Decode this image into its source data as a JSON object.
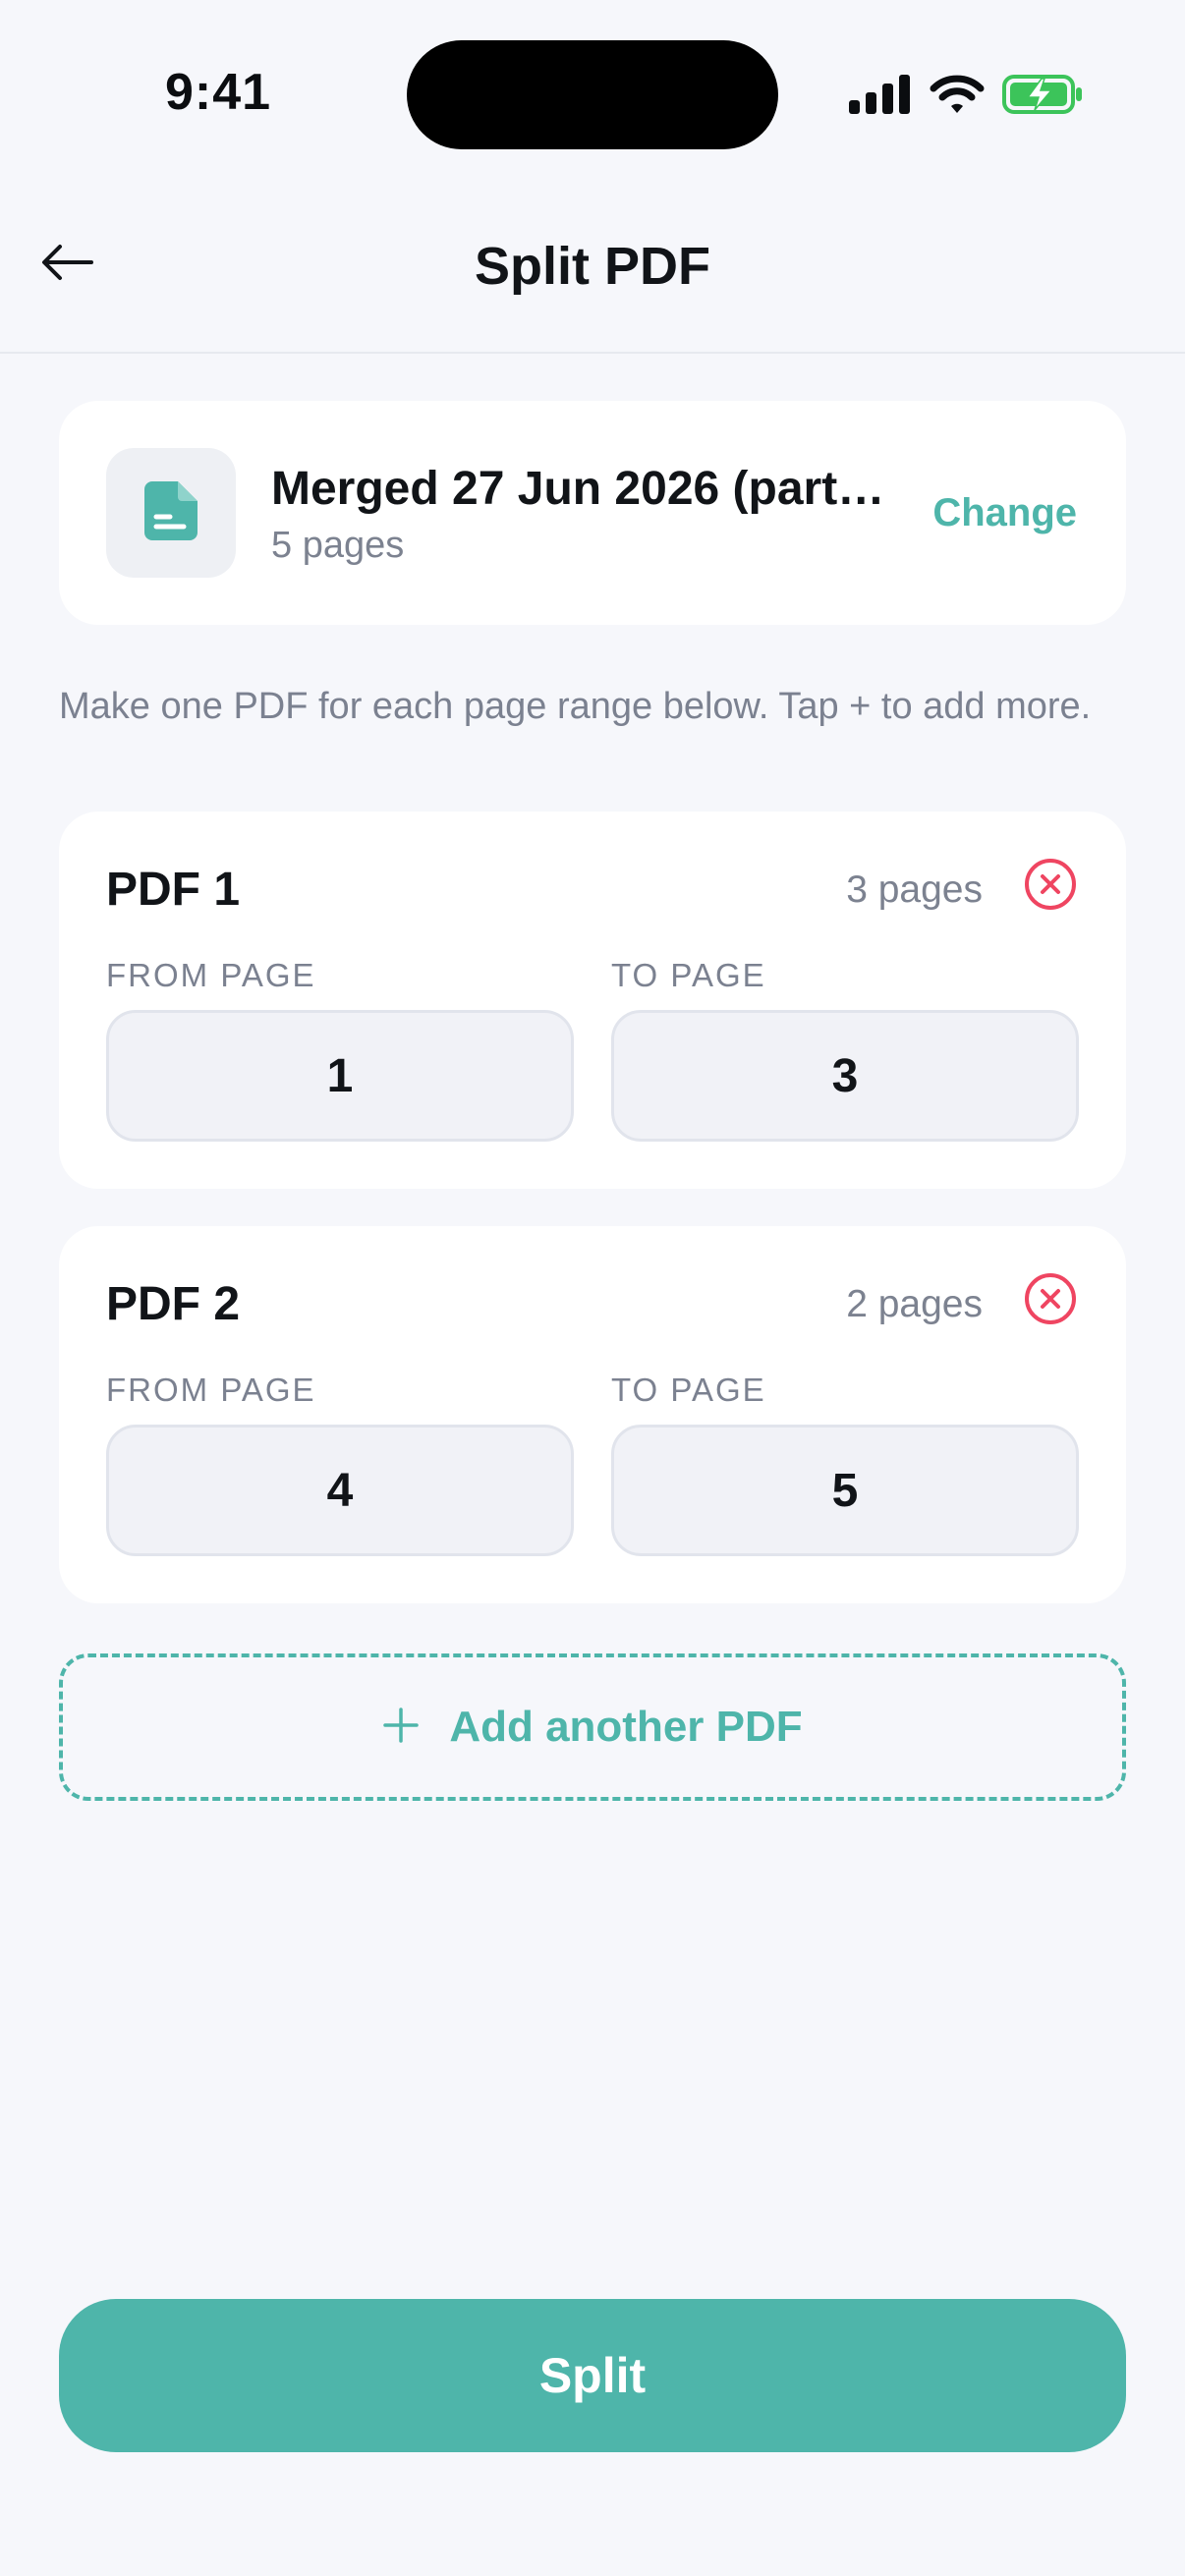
{
  "status_bar": {
    "time": "9:41"
  },
  "header": {
    "title": "Split PDF",
    "back_icon": "arrow-left-icon"
  },
  "file": {
    "name": "Merged 27 Jun 2026 (part…",
    "pages": "5 pages",
    "change_label": "Change",
    "icon": "document-icon"
  },
  "instructions": "Make one PDF for each page range below. Tap + to add more.",
  "ranges": [
    {
      "title": "PDF 1",
      "count": "3 pages",
      "from_label": "FROM PAGE",
      "to_label": "TO PAGE",
      "from": "1",
      "to": "3"
    },
    {
      "title": "PDF 2",
      "count": "2 pages",
      "from_label": "FROM PAGE",
      "to_label": "TO PAGE",
      "from": "4",
      "to": "5"
    }
  ],
  "add_button": {
    "label": "Add another PDF"
  },
  "split_button": {
    "label": "Split"
  },
  "colors": {
    "accent": "#4eb5aa",
    "danger": "#ef4561",
    "background": "#f6f7fb",
    "card": "#ffffff",
    "muted_text": "#7c8290"
  }
}
